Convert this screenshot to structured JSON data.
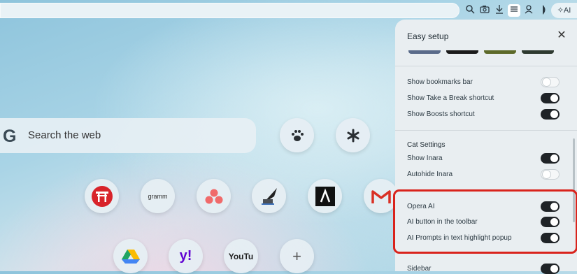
{
  "toolbar": {
    "icons": [
      "search-icon",
      "camera-icon",
      "download-icon",
      "easy-setup-icon",
      "account-icon",
      "sidebar-icon"
    ],
    "ai_label": "AI"
  },
  "search": {
    "logo": "G",
    "placeholder": "Search the web"
  },
  "speed_dial": {
    "gramm_label": "gramm",
    "youtube_label": "YouTu",
    "yahoo_label": "y!",
    "add_label": "+"
  },
  "easy_setup": {
    "title": "Easy setup",
    "close": "✕",
    "rows": [
      {
        "label": "Show bookmarks bar",
        "on": false
      },
      {
        "label": "Show Take a Break shortcut",
        "on": true
      },
      {
        "label": "Show Boosts shortcut",
        "on": true
      }
    ],
    "cat_title": "Cat Settings",
    "cat_rows": [
      {
        "label": "Show Inara",
        "on": true
      },
      {
        "label": "Autohide Inara",
        "on": false
      }
    ],
    "ai_rows": [
      {
        "label": "Opera AI",
        "on": true
      },
      {
        "label": "AI button in the toolbar",
        "on": true
      },
      {
        "label": "AI Prompts in text highlight popup",
        "on": true
      }
    ],
    "sidebar_title": "Sidebar",
    "highlight_color": "#d9231c"
  }
}
